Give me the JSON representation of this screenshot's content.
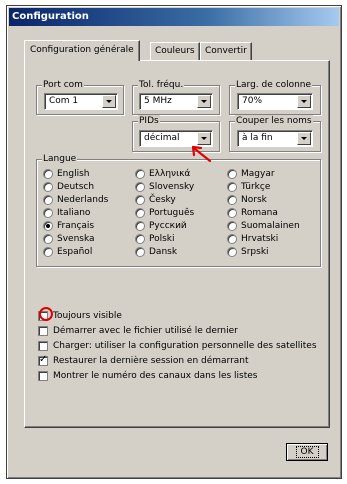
{
  "window": {
    "title": "Configuration"
  },
  "tabs": [
    {
      "label": "Configuration générale",
      "active": true
    },
    {
      "label": "Couleurs",
      "active": false
    },
    {
      "label": "Convertir",
      "active": false
    }
  ],
  "port_com": {
    "label": "Port com",
    "value": "Com 1"
  },
  "tol_frequ": {
    "label": "Tol. fréqu.",
    "value": "5 MHz"
  },
  "larg_colonne": {
    "label": "Larg. de colonne",
    "value": "70%"
  },
  "pids": {
    "label": "PIDs",
    "value": "décimal"
  },
  "couper_noms": {
    "label": "Couper les noms",
    "value": "à la fin"
  },
  "langue": {
    "label": "Langue",
    "selected": "Français",
    "options": [
      "English",
      "Ελληνικά",
      "Magyar",
      "Deutsch",
      "Slovensky",
      "Türkçe",
      "Nederlands",
      "Česky",
      "Norsk",
      "Italiano",
      "Português",
      "Romana",
      "Français",
      "Русский",
      "Suomalainen",
      "Svenska",
      "Polski",
      "Hrvatski",
      "Español",
      "Dansk",
      "Srpski"
    ]
  },
  "options": [
    {
      "label": "Toujours visible",
      "checked": false
    },
    {
      "label": "Démarrer avec le fichier utilisé le dernier",
      "checked": false
    },
    {
      "label": "Charger: utiliser la configuration personnelle des satellites",
      "checked": false
    },
    {
      "label": "Restaurer la dernière session en démarrant",
      "checked": true
    },
    {
      "label": "Montrer le numéro des canaux dans les listes",
      "checked": false
    }
  ],
  "ok_button": {
    "label": "OK"
  },
  "annotations": {
    "color": "#e00000"
  },
  "colors": {
    "title_start": "#0a246a",
    "title_end": "#a6caf0",
    "face": "#d4d0c8"
  }
}
